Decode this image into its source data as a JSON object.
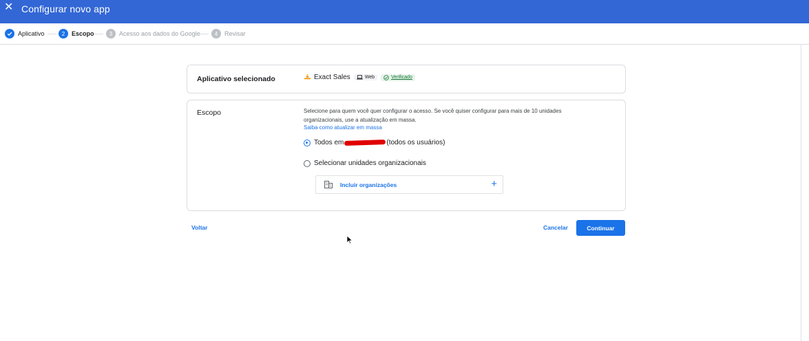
{
  "header": {
    "close_icon": "close-icon",
    "title": "Configurar novo app",
    "bg_color": "#3367d6"
  },
  "stepper": {
    "steps": [
      {
        "num": "",
        "label": "Aplicativo",
        "state": "done"
      },
      {
        "num": "2",
        "label": "Escopo",
        "state": "active"
      },
      {
        "num": "3",
        "label": "Acesso aos dados do Google",
        "state": "pending"
      },
      {
        "num": "4",
        "label": "Revisar",
        "state": "pending"
      }
    ]
  },
  "app_card": {
    "label": "Aplicativo selecionado",
    "app_name": "Exact Sales",
    "platform": "Web",
    "verified": "Verificado"
  },
  "scope": {
    "label": "Escopo",
    "description": "Selecione para quem você quer configurar o acesso. Se você quiser configurar para mais de 10 unidades organizacionais, use a atualização em massa.",
    "bulk_link": "Saiba como atualizar em massa",
    "option_all_prefix": "Todos em",
    "option_all_suffix": "(todos os usuários)",
    "option_org": "Selecionar unidades organizacionais",
    "selected": "all",
    "include_orgs": "Incluir organizações"
  },
  "footer": {
    "back": "Voltar",
    "cancel": "Cancelar",
    "continue": "Continuar"
  },
  "colors": {
    "accent": "#1a73e8",
    "verified_bg": "#e6f4ea",
    "verified_text": "#137333"
  }
}
